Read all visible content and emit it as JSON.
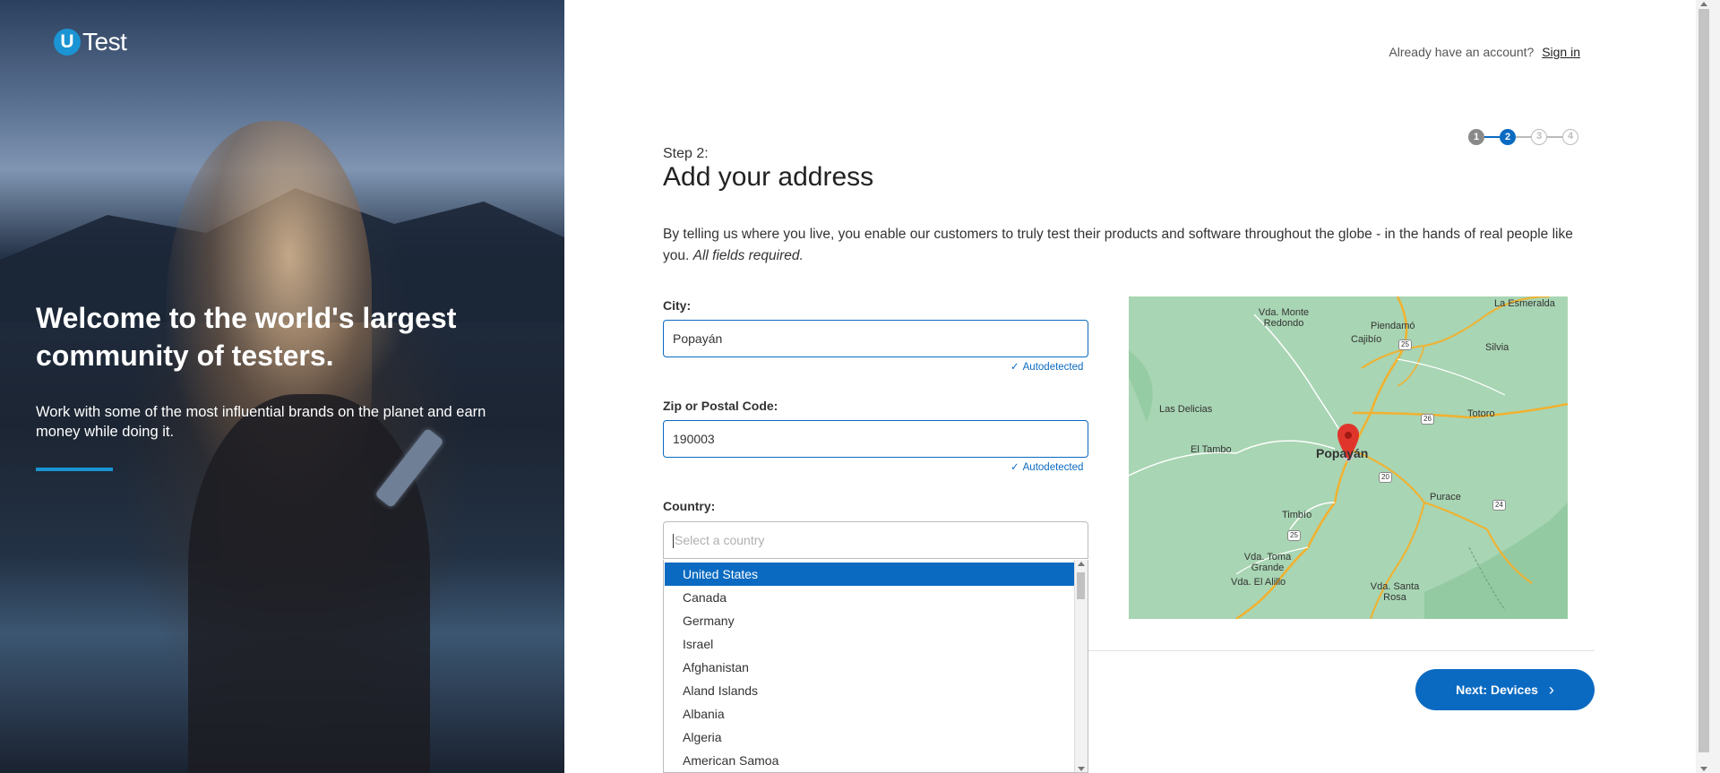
{
  "brand": {
    "logo_letter": "U",
    "logo_name": "Test"
  },
  "hero": {
    "title": "Welcome to the world's largest community of testers.",
    "subtitle": "Work with some of the most influential brands on the planet and earn money while doing it."
  },
  "header": {
    "account_prompt": "Already have an account?",
    "sign_in_label": "Sign in"
  },
  "stepper": {
    "steps": [
      "1",
      "2",
      "3",
      "4"
    ],
    "current_step": 2
  },
  "form": {
    "step_label": "Step 2:",
    "title": "Add your address",
    "intro": "By telling us where you live, you enable our customers to truly test their products and software throughout the globe - in the hands of real people like you.",
    "intro_required": "All fields required.",
    "city": {
      "label": "City:",
      "value": "Popayán",
      "status": "Autodetected"
    },
    "zip": {
      "label": "Zip or Postal Code:",
      "value": "190003",
      "status": "Autodetected"
    },
    "country": {
      "label": "Country:",
      "placeholder": "Select a country",
      "options": [
        "United States",
        "Canada",
        "Germany",
        "Israel",
        "Afghanistan",
        "Aland Islands",
        "Albania",
        "Algeria",
        "American Samoa"
      ],
      "highlighted": "United States"
    }
  },
  "map": {
    "places": [
      "La Esmeralda",
      "Vda. Monte Redondo",
      "Piendamó",
      "Cajibío",
      "Silvia",
      "Las Delicias",
      "Totoro",
      "El Tambo",
      "Popayán",
      "Purace",
      "Timbío",
      "Vda. Toma Grande",
      "Vda. El Alillo",
      "Vda. Santa Rosa"
    ],
    "road_numbers": [
      "25",
      "26",
      "20",
      "24",
      "25"
    ]
  },
  "actions": {
    "next_label": "Next: Devices"
  },
  "colors": {
    "accent": "#0a6ac1",
    "brand": "#1a94d3",
    "map_green": "#a8d5b3",
    "road": "#f2b12e",
    "marker": "#e0352b"
  }
}
